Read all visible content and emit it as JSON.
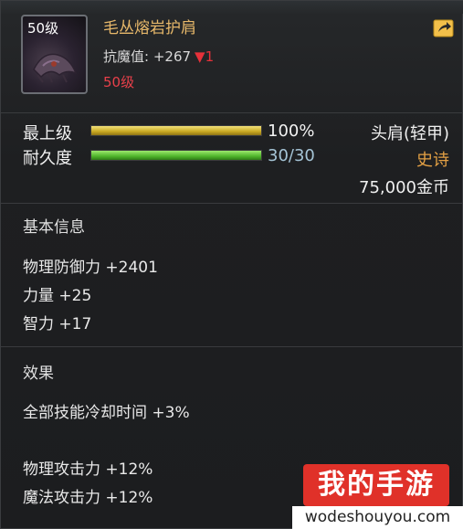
{
  "item": {
    "icon_level": "50级",
    "name": "毛丛熔岩护肩",
    "resist_label": "抗魔值:",
    "resist_value": "+267",
    "resist_change": "▼1",
    "required_level": "50级"
  },
  "bars": {
    "level_label": "最上级",
    "level_percent_text": "100%",
    "level_fill": 1.0,
    "durability_label": "耐久度",
    "durability_text": "30/30",
    "durability_fill": 1.0
  },
  "right": {
    "slot": "头肩(轻甲)",
    "rarity": "史诗",
    "price": "75,000金币"
  },
  "basic": {
    "title": "基本信息",
    "stats": [
      "物理防御力 +2401",
      "力量 +25",
      "智力 +17"
    ]
  },
  "effects": {
    "title": "效果",
    "lines": [
      "全部技能冷却时间 +3%",
      "物理攻击力 +12%",
      "魔法攻击力 +12%"
    ]
  },
  "watermark": {
    "badge": "我的手游",
    "site": "wodeshouyou.com"
  },
  "colors": {
    "name": "#e7b86a",
    "rarity": "#e3a044",
    "level_requirement": "#e8404a",
    "level_bar": "#d1b12b",
    "durability_bar": "#4fb52b"
  }
}
